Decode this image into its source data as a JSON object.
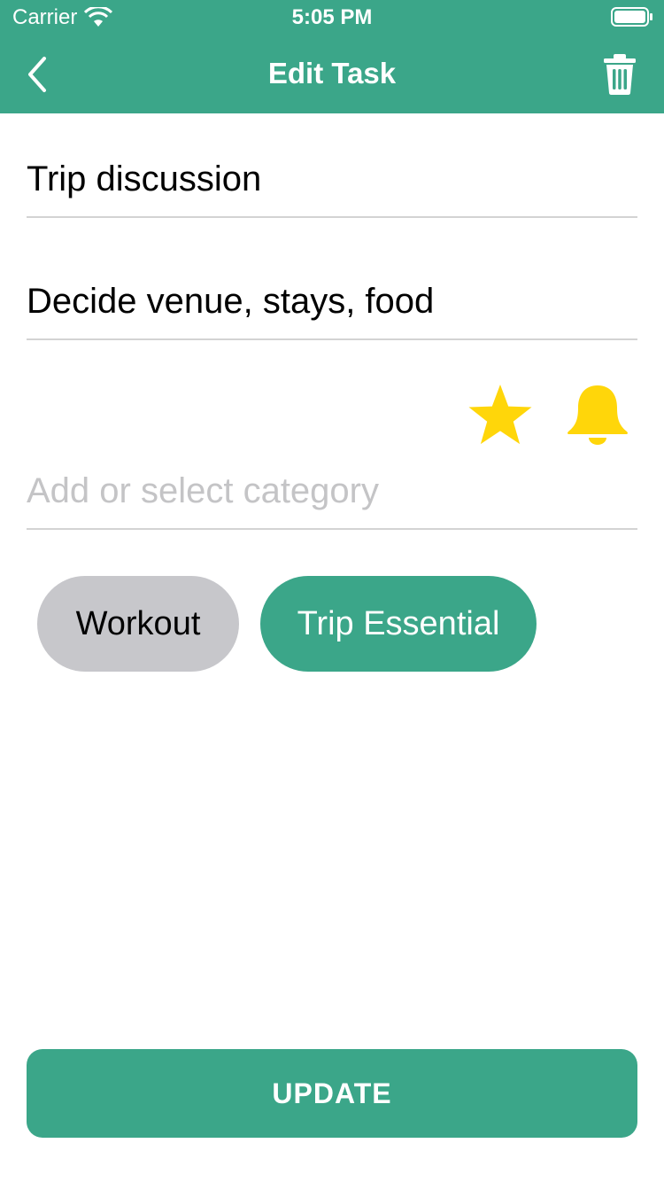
{
  "status_bar": {
    "carrier": "Carrier",
    "time": "5:05 PM"
  },
  "nav": {
    "title": "Edit Task",
    "back_icon": "chevron-left-icon",
    "delete_icon": "trash-icon"
  },
  "form": {
    "title_value": "Trip discussion",
    "description_value": "Decide venue, stays, food",
    "category_placeholder": "Add or select category",
    "star_icon": "star-icon",
    "bell_icon": "bell-icon"
  },
  "categories": [
    {
      "label": "Workout",
      "selected": false
    },
    {
      "label": "Trip Essential",
      "selected": true
    }
  ],
  "update_label": "UPDATE",
  "colors": {
    "primary": "#3ba689",
    "icon_yellow": "#ffd60a",
    "chip_unselected": "#c7c7cb"
  }
}
